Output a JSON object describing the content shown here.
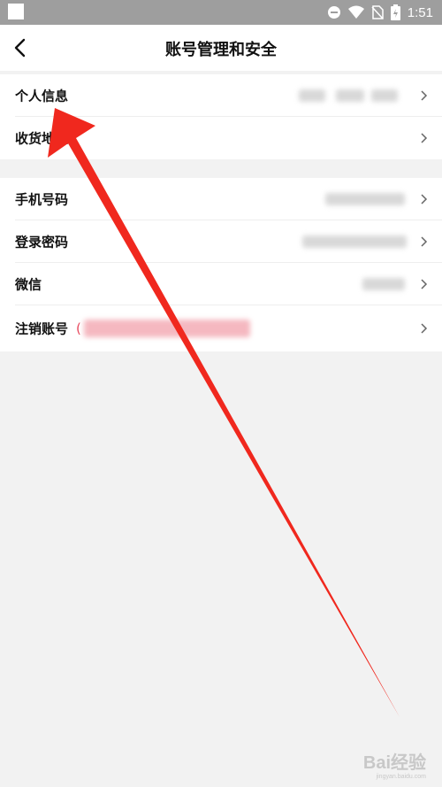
{
  "status_bar": {
    "time": "1:51"
  },
  "header": {
    "title": "账号管理和安全"
  },
  "group1": [
    {
      "label": "个人信息"
    },
    {
      "label": "收货地址"
    }
  ],
  "group2": [
    {
      "label": "手机号码"
    },
    {
      "label": "登录密码"
    },
    {
      "label": "微信"
    },
    {
      "label": "注销账号",
      "paren": "("
    }
  ],
  "watermark": {
    "brand": "Bai经验",
    "url": "jingyan.baidu.com"
  },
  "colors": {
    "arrow": "#f0281e",
    "background": "#f2f2f2",
    "status_bar": "#9e9e9e"
  }
}
